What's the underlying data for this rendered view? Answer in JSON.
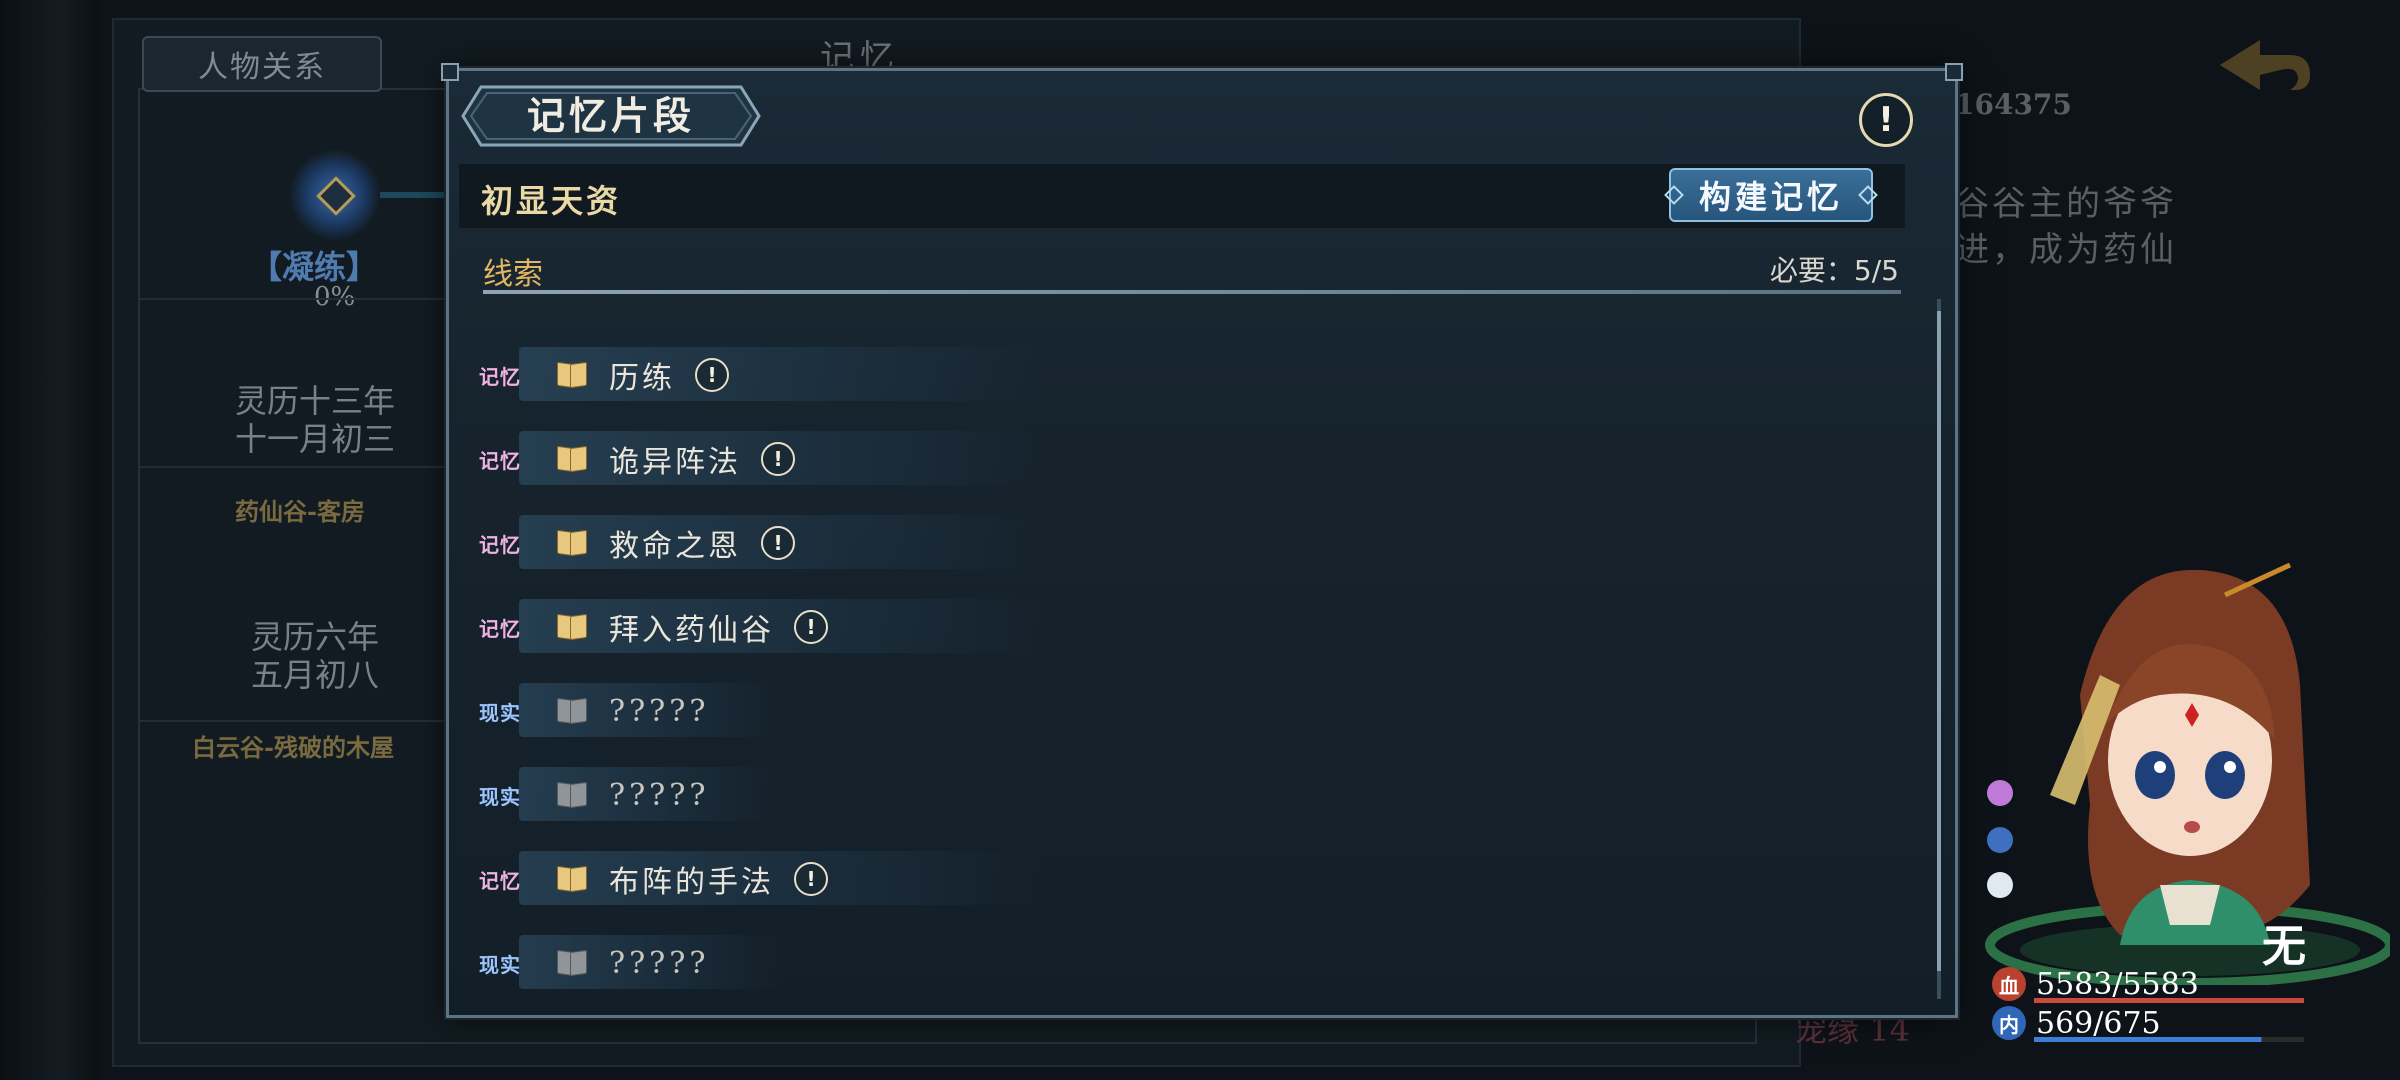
{
  "background": {
    "tab_label": "人物关系",
    "title": "记忆",
    "node_label": "【凝练】",
    "node_progress": "0%",
    "entries": [
      {
        "date_line1": "灵历十三年",
        "date_line2": "十一月初三",
        "location": "药仙谷-客房"
      },
      {
        "date_line1": "灵历六年",
        "date_line2": "五月初八",
        "location": "白云谷-残破的木屋"
      }
    ],
    "id_number": "164375",
    "description_line1": "谷谷主的爷爷",
    "description_line2": "进，成为药仙",
    "bottom_text": "宠缘 14"
  },
  "dialog": {
    "title": "记忆片段",
    "fragment_name": "初显天资",
    "build_button": "构建记忆",
    "clues_label": "线索",
    "required": "必要：5/5",
    "clues": [
      {
        "tag": "记忆",
        "type": "memory",
        "text": "历练",
        "alert": true
      },
      {
        "tag": "记忆",
        "type": "memory",
        "text": "诡异阵法",
        "alert": true
      },
      {
        "tag": "记忆",
        "type": "memory",
        "text": "救命之恩",
        "alert": true
      },
      {
        "tag": "记忆",
        "type": "memory",
        "text": "拜入药仙谷",
        "alert": true
      },
      {
        "tag": "现实",
        "type": "reality",
        "text": "?????",
        "alert": false
      },
      {
        "tag": "现实",
        "type": "reality",
        "text": "?????",
        "alert": false
      },
      {
        "tag": "记忆",
        "type": "memory",
        "text": "布阵的手法",
        "alert": true
      },
      {
        "tag": "现实",
        "type": "reality",
        "text": "?????",
        "alert": false
      }
    ]
  },
  "character": {
    "name": "无",
    "hp": "5583/5583",
    "mp": "569/675",
    "hp_icon": "血",
    "mp_icon": "内",
    "hp_fraction": 1.0,
    "mp_fraction": 0.843,
    "hp_color": "#c94b3a",
    "mp_color": "#3b7fd6"
  }
}
